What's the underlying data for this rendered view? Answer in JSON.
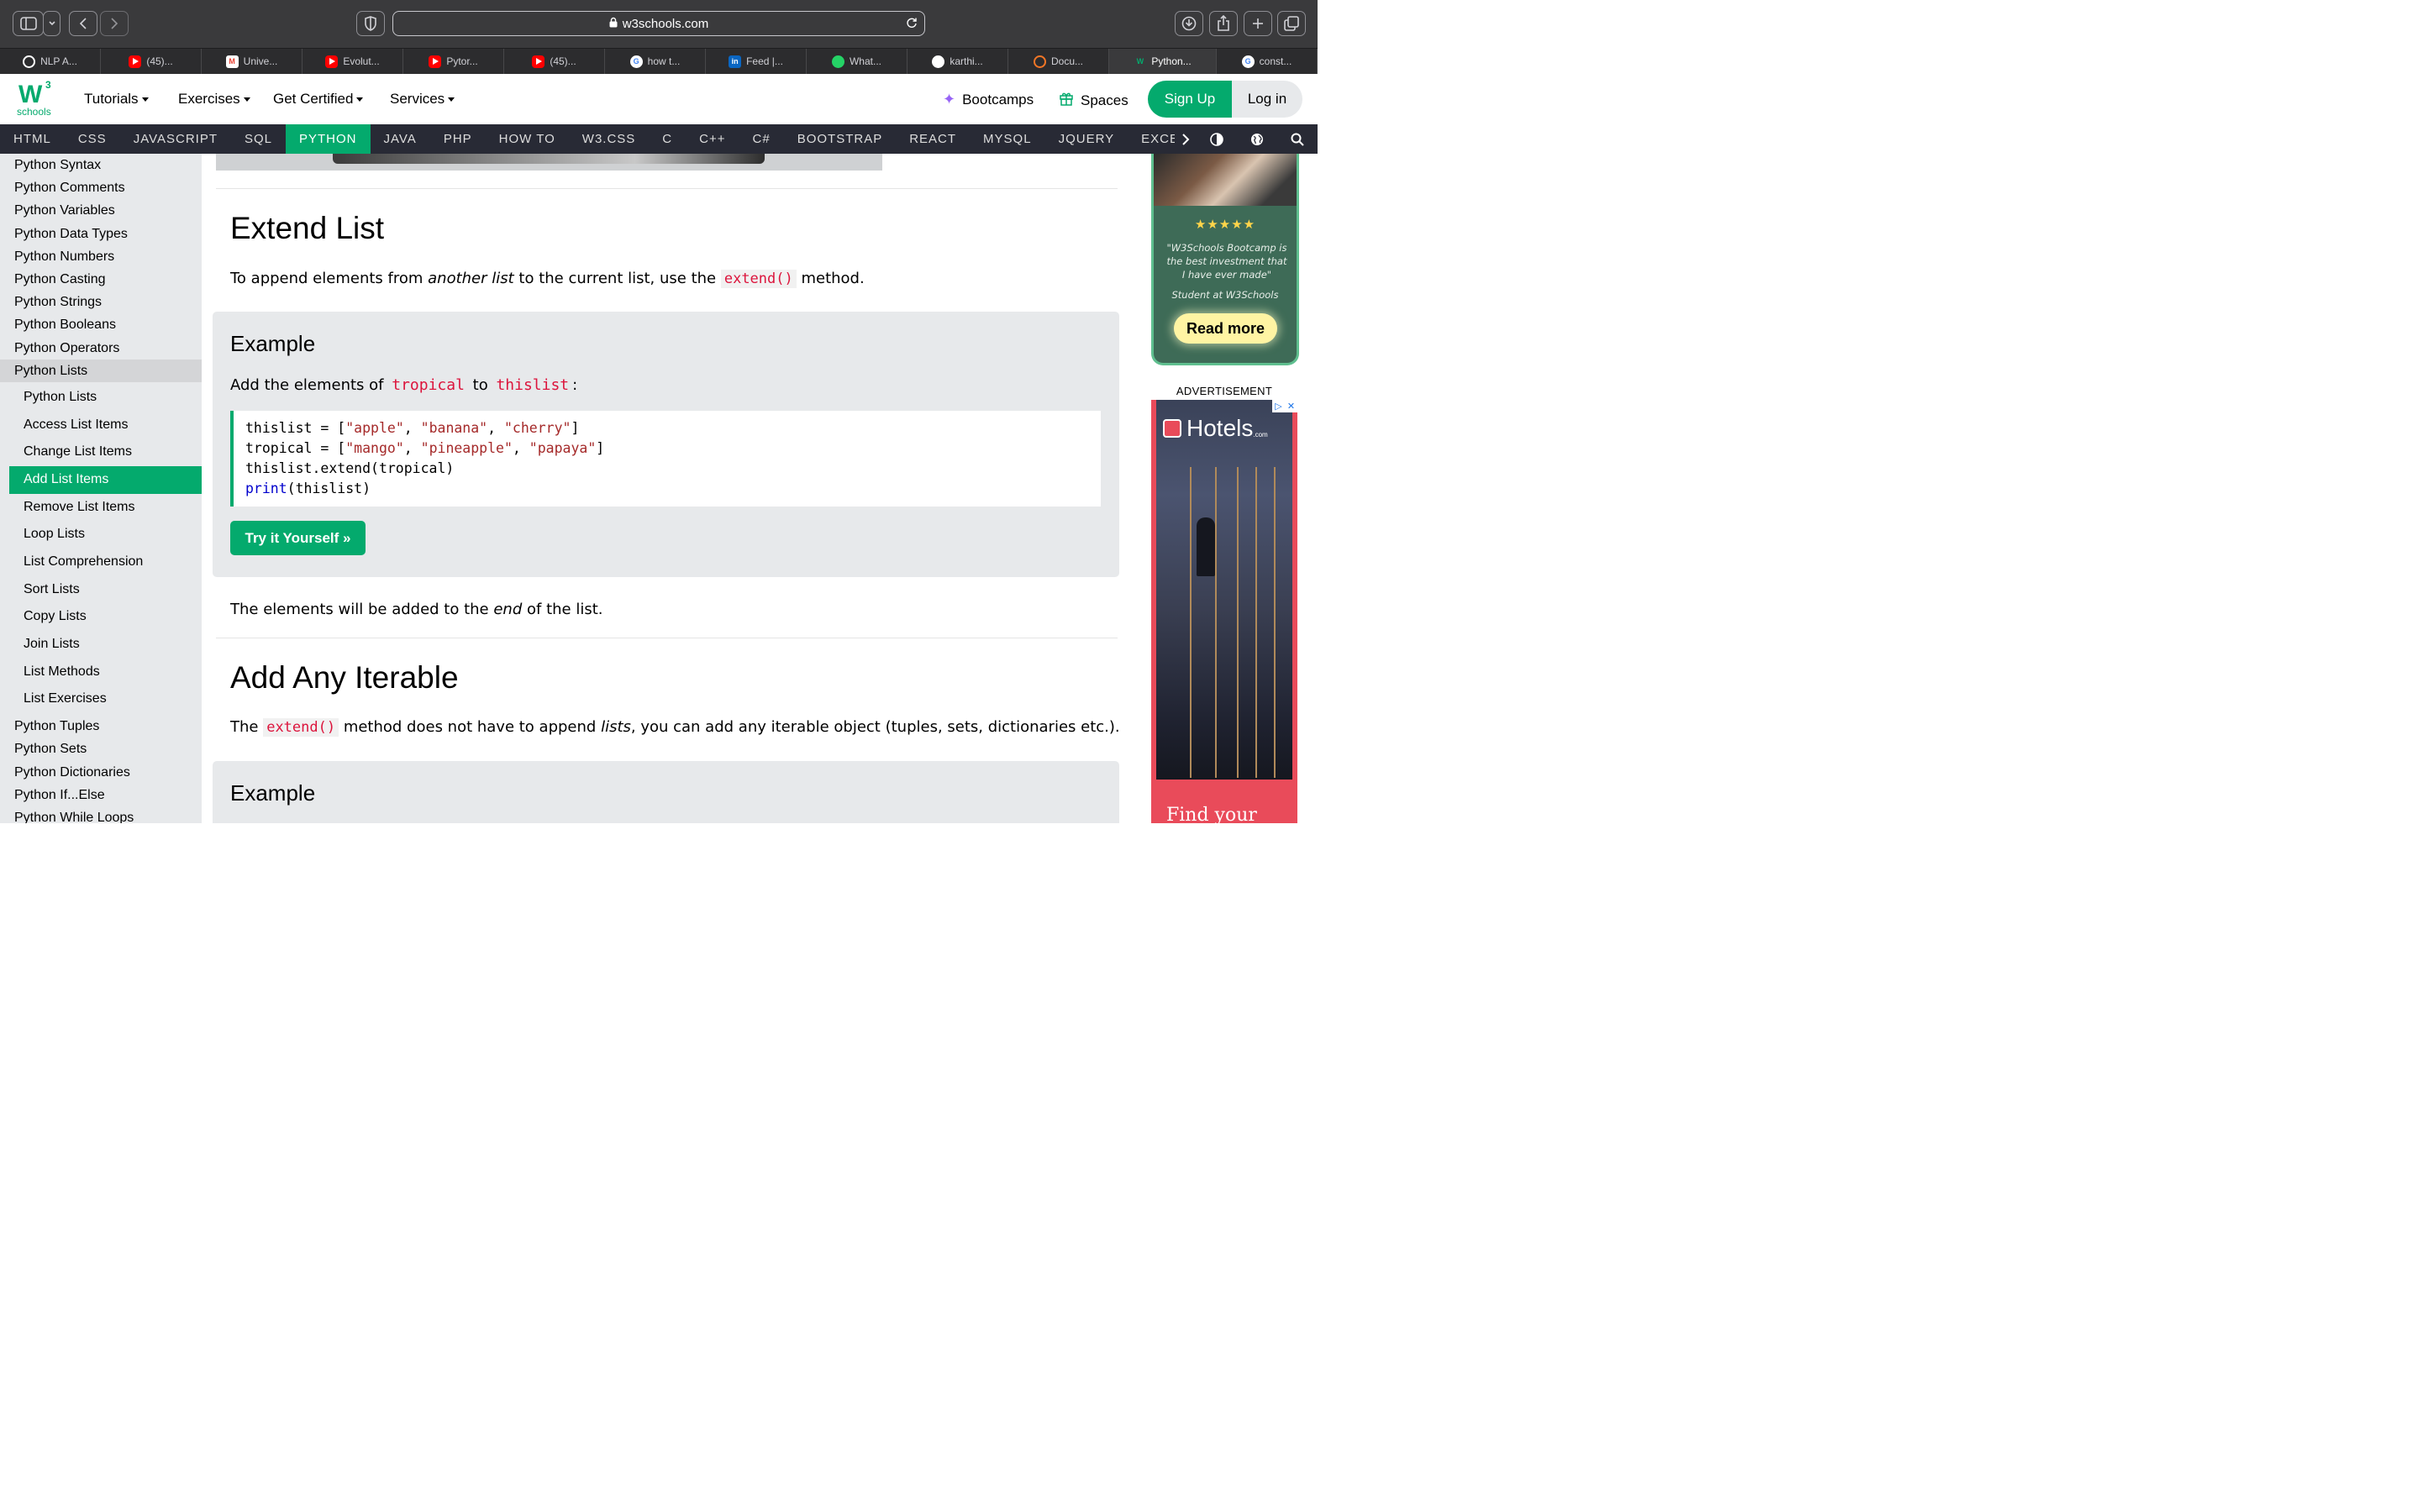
{
  "browser": {
    "url": "w3schools.com",
    "tabs": [
      {
        "label": "NLP A...",
        "icon": "openai-icon",
        "color": "#ffffff"
      },
      {
        "label": "(45)...",
        "icon": "youtube-icon",
        "color": "#ff0000"
      },
      {
        "label": "Unive...",
        "icon": "gmail-icon",
        "color": "#ea4335"
      },
      {
        "label": "Evolut...",
        "icon": "youtube-icon",
        "color": "#ff0000"
      },
      {
        "label": "Pytor...",
        "icon": "youtube-icon",
        "color": "#ff0000"
      },
      {
        "label": "(45)...",
        "icon": "youtube-icon",
        "color": "#ff0000"
      },
      {
        "label": "how t...",
        "icon": "google-icon",
        "color": "#4285f4"
      },
      {
        "label": "Feed |...",
        "icon": "linkedin-icon",
        "color": "#0a66c2"
      },
      {
        "label": "What...",
        "icon": "whatsapp-icon",
        "color": "#25d366"
      },
      {
        "label": "karthi...",
        "icon": "github-icon",
        "color": "#ffffff"
      },
      {
        "label": "Docu...",
        "icon": "jupyter-icon",
        "color": "#f37626"
      },
      {
        "label": "Python...",
        "icon": "w3schools-icon",
        "color": "#04aa6d",
        "active": true
      },
      {
        "label": "const...",
        "icon": "google-icon",
        "color": "#4285f4"
      }
    ]
  },
  "header": {
    "logo_text": "W",
    "logo_sup": "3",
    "logo_sub": "schools",
    "menu": [
      "Tutorials",
      "Exercises",
      "Get Certified",
      "Services"
    ],
    "bootcamps": "Bootcamps",
    "spaces": "Spaces",
    "signup": "Sign Up",
    "login": "Log in"
  },
  "subjects": [
    "HTML",
    "CSS",
    "JAVASCRIPT",
    "SQL",
    "PYTHON",
    "JAVA",
    "PHP",
    "HOW TO",
    "W3.CSS",
    "C",
    "C++",
    "C#",
    "BOOTSTRAP",
    "REACT",
    "MYSQL",
    "JQUERY",
    "EXCEL"
  ],
  "subjects_active": "PYTHON",
  "sidebar": {
    "top_before": [
      "Python Syntax",
      "Python Comments",
      "Python Variables",
      "Python Data Types",
      "Python Numbers",
      "Python Casting",
      "Python Strings",
      "Python Booleans",
      "Python Operators"
    ],
    "open_item": "Python Lists",
    "sub_items": [
      "Python Lists",
      "Access List Items",
      "Change List Items",
      "Add List Items",
      "Remove List Items",
      "Loop Lists",
      "List Comprehension",
      "Sort Lists",
      "Copy Lists",
      "Join Lists",
      "List Methods",
      "List Exercises"
    ],
    "sub_active": "Add List Items",
    "top_after": [
      "Python Tuples",
      "Python Sets",
      "Python Dictionaries",
      "Python If...Else",
      "Python While Loops"
    ]
  },
  "main": {
    "extend_title": "Extend List",
    "extend_p1": "To append elements from ",
    "extend_p1_em": "another list",
    "extend_p1_b": " to the current list, use the ",
    "extend_p1_code": "extend()",
    "extend_p1_c": " method.",
    "example1": {
      "heading": "Example",
      "text_a": "Add the elements of ",
      "kw1": "tropical",
      "text_b": " to ",
      "kw2": "thislist",
      "text_c": ":",
      "code": [
        {
          "pre": "thislist = [",
          "parts": [
            "\"apple\"",
            "\"banana\"",
            "\"cherry\""
          ],
          "post": "]"
        },
        {
          "pre": "tropical = [",
          "parts": [
            "\"mango\"",
            "\"pineapple\"",
            "\"papaya\""
          ],
          "post": "]"
        },
        {
          "plain": "thislist.extend(tropical)"
        },
        {
          "fn": "print",
          "rest": "(thislist)"
        }
      ],
      "try_label": "Try it Yourself »"
    },
    "end_p_a": "The elements will be added to the ",
    "end_p_em": "end",
    "end_p_b": " of the list.",
    "iterable_title": "Add Any Iterable",
    "iter_p_a": "The ",
    "iter_p_code": "extend()",
    "iter_p_b": " method does not have to append ",
    "iter_p_em": "lists",
    "iter_p_c": ", you can add any iterable object (tuples, sets, dictionaries etc.).",
    "example2_heading": "Example"
  },
  "right": {
    "stars": "★★★★★",
    "quote": "\"W3Schools Bootcamp is the best investment that I have ever made\"",
    "who": "Student at W3Schools",
    "read_more": "Read more",
    "ad_label": "ADVERTISEMENT",
    "ad_brand": "Hotels",
    "ad_brand_suffix": ".com",
    "ad_tagline": "Find your"
  },
  "colors": {
    "accent": "#04aa6d",
    "dark_bar": "#282a35",
    "code_red": "#dc143c"
  }
}
